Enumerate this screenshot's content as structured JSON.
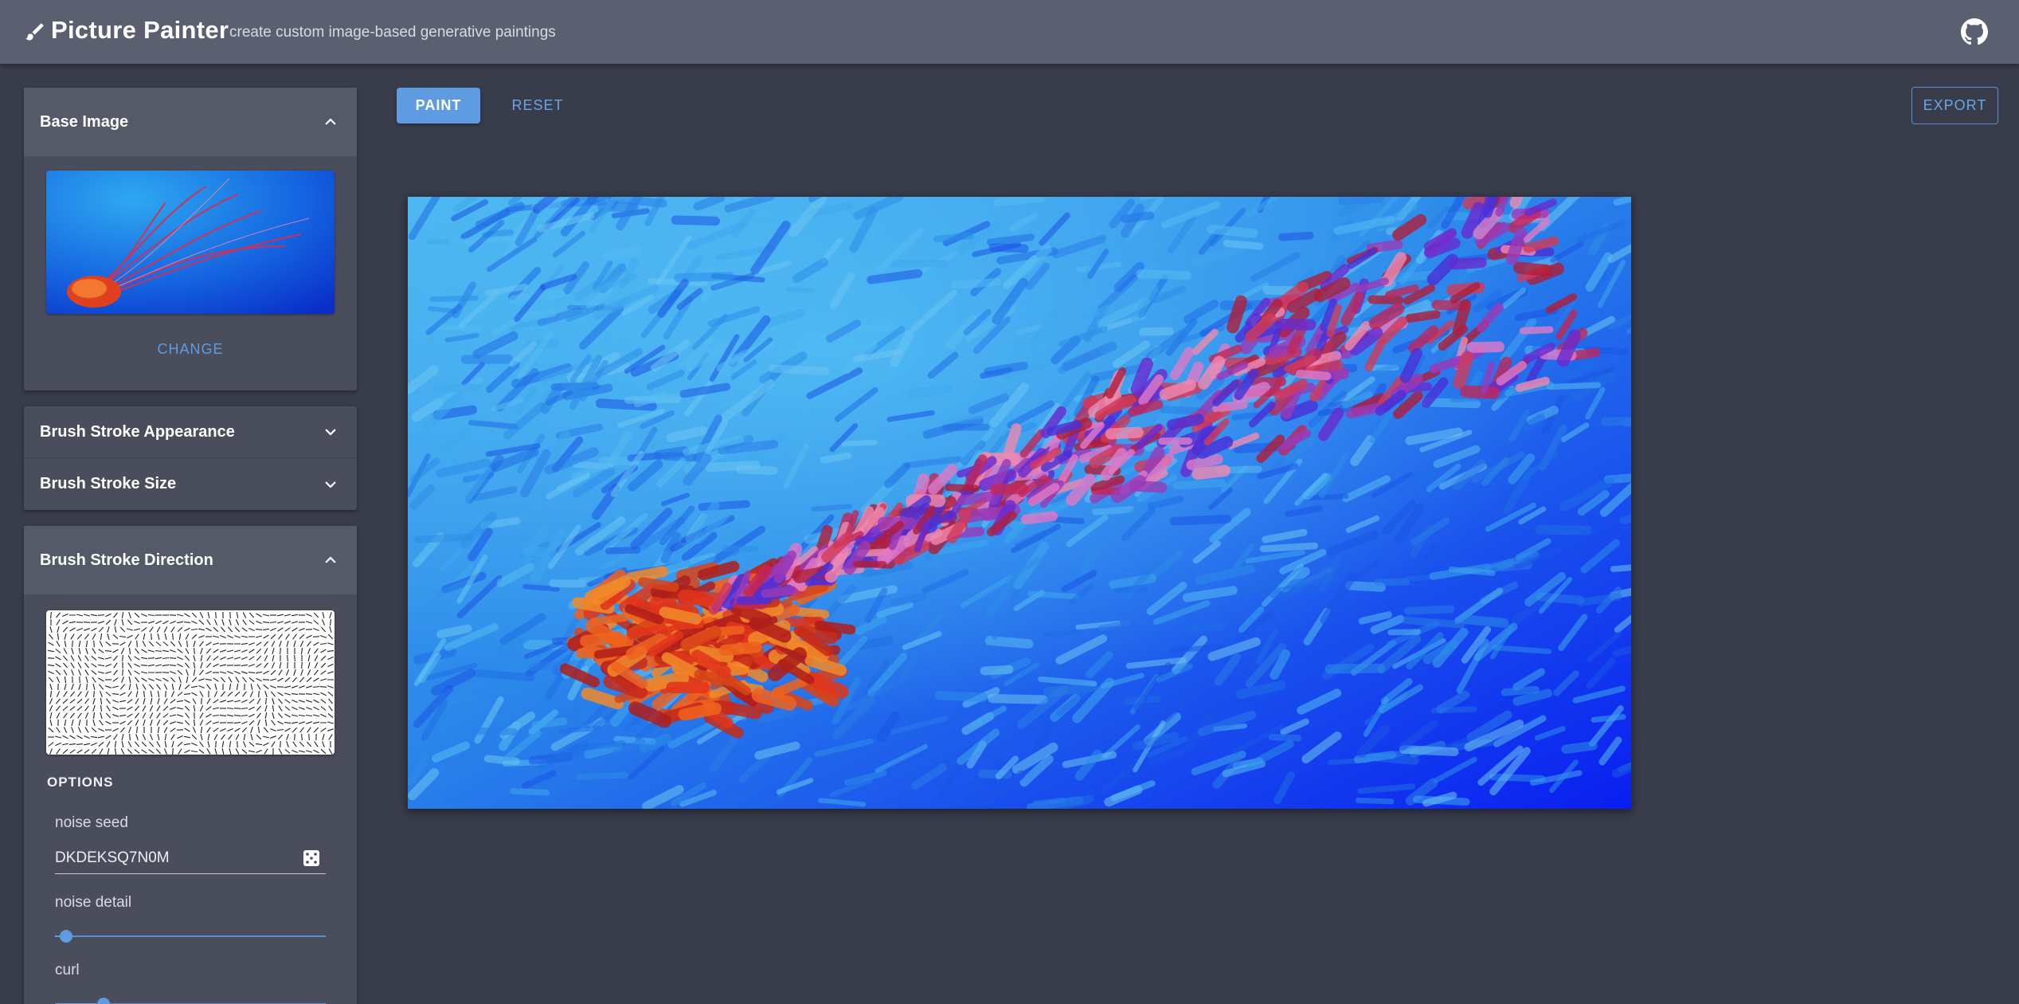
{
  "header": {
    "title": "Picture Painter",
    "subtitle": "create custom image-based generative paintings",
    "brush_icon": "brush-icon",
    "github_icon": "github-icon"
  },
  "toolbar": {
    "paint_label": "PAINT",
    "reset_label": "RESET",
    "export_label": "EXPORT"
  },
  "sidebar": {
    "base_image": {
      "title": "Base Image",
      "expanded": true,
      "change_label": "CHANGE"
    },
    "brush_appearance": {
      "title": "Brush Stroke Appearance",
      "expanded": false
    },
    "brush_size": {
      "title": "Brush Stroke Size",
      "expanded": false
    },
    "brush_direction": {
      "title": "Brush Stroke Direction",
      "expanded": true,
      "options_label": "OPTIONS",
      "noise_seed_label": "noise seed",
      "noise_seed_value": "DKDEKSQ7N0M",
      "noise_detail_label": "noise detail",
      "noise_detail_value": 0.04,
      "curl_label": "curl",
      "curl_value": 0.18
    }
  },
  "colors": {
    "accent": "#5e9be0",
    "background": "#383c4b",
    "appbar": "#5b6070",
    "panel": "#4a4e5c"
  }
}
